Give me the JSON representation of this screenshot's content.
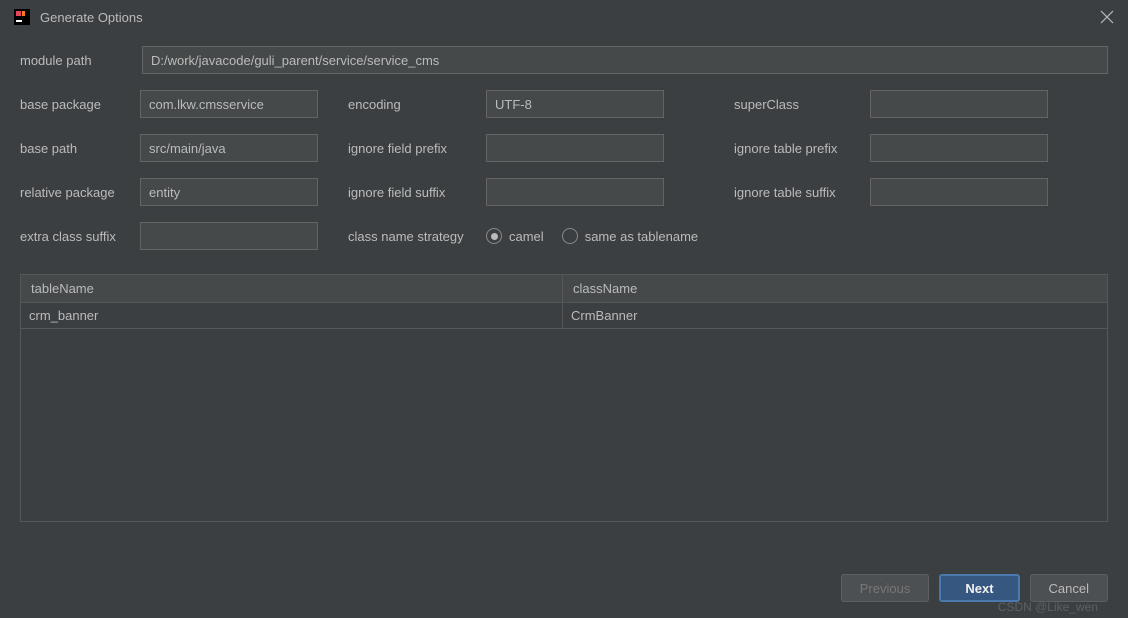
{
  "window": {
    "title": "Generate Options"
  },
  "fields": {
    "module_path": {
      "label": "module path",
      "value": "D:/work/javacode/guli_parent/service/service_cms"
    },
    "base_package": {
      "label": "base package",
      "value": "com.lkw.cmsservice"
    },
    "encoding": {
      "label": "encoding",
      "value": "UTF-8"
    },
    "super_class": {
      "label": "superClass",
      "value": ""
    },
    "base_path": {
      "label": "base path",
      "value": "src/main/java"
    },
    "ignore_field_prefix": {
      "label": "ignore field prefix",
      "value": ""
    },
    "ignore_table_prefix": {
      "label": "ignore table prefix",
      "value": ""
    },
    "relative_package": {
      "label": "relative package",
      "value": "entity"
    },
    "ignore_field_suffix": {
      "label": "ignore field suffix",
      "value": ""
    },
    "ignore_table_suffix": {
      "label": "ignore table suffix",
      "value": ""
    },
    "extra_class_suffix": {
      "label": "extra class suffix",
      "value": ""
    },
    "class_name_strategy": {
      "label": "class name strategy",
      "options": {
        "camel": "camel",
        "same": "same as tablename"
      },
      "selected": "camel"
    }
  },
  "table": {
    "headers": {
      "tableName": "tableName",
      "className": "className"
    },
    "rows": [
      {
        "tableName": "crm_banner",
        "className": "CrmBanner"
      }
    ]
  },
  "buttons": {
    "previous": "Previous",
    "next": "Next",
    "cancel": "Cancel"
  },
  "watermark": "CSDN @Like_wen"
}
